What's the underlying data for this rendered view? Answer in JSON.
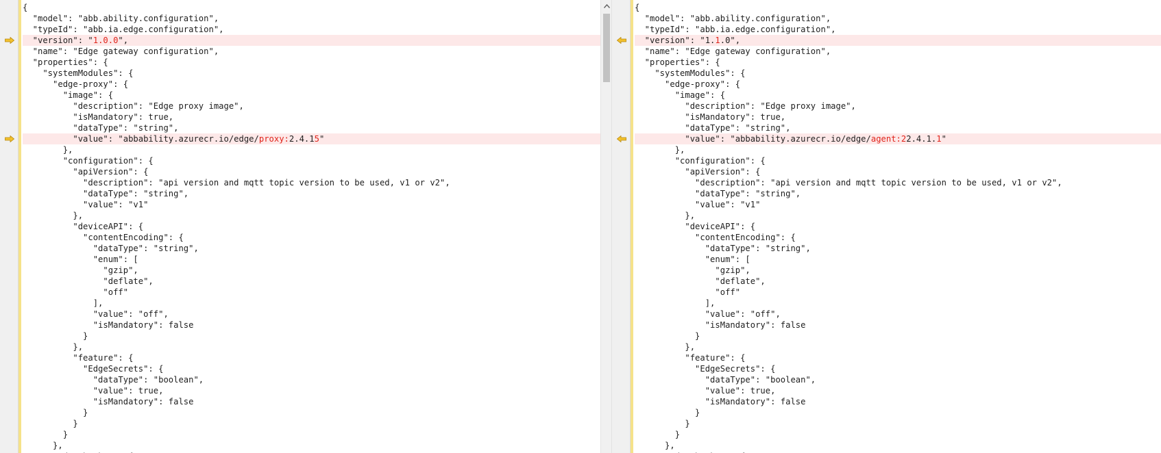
{
  "left": {
    "lines": [
      {
        "segs": [
          {
            "t": "{"
          }
        ]
      },
      {
        "segs": [
          {
            "t": "  \"model\": \"abb.ability.configuration\","
          }
        ]
      },
      {
        "segs": [
          {
            "t": "  \"typeId\": \"abb.ia.edge.configuration\","
          }
        ]
      },
      {
        "diff": true,
        "segs": [
          {
            "t": "  \"version\": \""
          },
          {
            "t": "1.0.0",
            "d": true
          },
          {
            "t": "\","
          }
        ]
      },
      {
        "segs": [
          {
            "t": "  \"name\": \"Edge gateway configuration\","
          }
        ]
      },
      {
        "segs": [
          {
            "t": "  \"properties\": {"
          }
        ]
      },
      {
        "segs": [
          {
            "t": "    \"systemModules\": {"
          }
        ]
      },
      {
        "segs": [
          {
            "t": "      \"edge-proxy\": {"
          }
        ]
      },
      {
        "segs": [
          {
            "t": "        \"image\": {"
          }
        ]
      },
      {
        "segs": [
          {
            "t": "          \"description\": \"Edge proxy image\","
          }
        ]
      },
      {
        "segs": [
          {
            "t": "          \"isMandatory\": true,"
          }
        ]
      },
      {
        "segs": [
          {
            "t": "          \"dataType\": \"string\","
          }
        ]
      },
      {
        "diff": true,
        "segs": [
          {
            "t": "          \"value\": \"abbability.azurecr.io/edge/"
          },
          {
            "t": "proxy:",
            "d": true
          },
          {
            "t": "2.4.1"
          },
          {
            "t": "5",
            "d": true
          },
          {
            "t": "\""
          }
        ]
      },
      {
        "segs": [
          {
            "t": "        },"
          }
        ]
      },
      {
        "segs": [
          {
            "t": "        \"configuration\": {"
          }
        ]
      },
      {
        "segs": [
          {
            "t": "          \"apiVersion\": {"
          }
        ]
      },
      {
        "segs": [
          {
            "t": "            \"description\": \"api version and mqtt topic version to be used, v1 or v2\","
          }
        ]
      },
      {
        "segs": [
          {
            "t": "            \"dataType\": \"string\","
          }
        ]
      },
      {
        "segs": [
          {
            "t": "            \"value\": \"v1\""
          }
        ]
      },
      {
        "segs": [
          {
            "t": "          },"
          }
        ]
      },
      {
        "segs": [
          {
            "t": "          \"deviceAPI\": {"
          }
        ]
      },
      {
        "segs": [
          {
            "t": "            \"contentEncoding\": {"
          }
        ]
      },
      {
        "segs": [
          {
            "t": "              \"dataType\": \"string\","
          }
        ]
      },
      {
        "segs": [
          {
            "t": "              \"enum\": ["
          }
        ]
      },
      {
        "segs": [
          {
            "t": "                \"gzip\","
          }
        ]
      },
      {
        "segs": [
          {
            "t": "                \"deflate\","
          }
        ]
      },
      {
        "segs": [
          {
            "t": "                \"off\""
          }
        ]
      },
      {
        "segs": [
          {
            "t": "              ],"
          }
        ]
      },
      {
        "segs": [
          {
            "t": "              \"value\": \"off\","
          }
        ]
      },
      {
        "segs": [
          {
            "t": "              \"isMandatory\": false"
          }
        ]
      },
      {
        "segs": [
          {
            "t": "            }"
          }
        ]
      },
      {
        "segs": [
          {
            "t": "          },"
          }
        ]
      },
      {
        "segs": [
          {
            "t": "          \"feature\": {"
          }
        ]
      },
      {
        "segs": [
          {
            "t": "            \"EdgeSecrets\": {"
          }
        ]
      },
      {
        "segs": [
          {
            "t": "              \"dataType\": \"boolean\","
          }
        ]
      },
      {
        "segs": [
          {
            "t": "              \"value\": true,"
          }
        ]
      },
      {
        "segs": [
          {
            "t": "              \"isMandatory\": false"
          }
        ]
      },
      {
        "segs": [
          {
            "t": "            }"
          }
        ]
      },
      {
        "segs": [
          {
            "t": "          }"
          }
        ]
      },
      {
        "segs": [
          {
            "t": "        }"
          }
        ]
      },
      {
        "segs": [
          {
            "t": "      },"
          }
        ]
      },
      {
        "segs": [
          {
            "t": "      \"edge-broker\": {"
          }
        ]
      }
    ]
  },
  "right": {
    "lines": [
      {
        "segs": [
          {
            "t": "{"
          }
        ]
      },
      {
        "segs": [
          {
            "t": "  \"model\": \"abb.ability.configuration\","
          }
        ]
      },
      {
        "segs": [
          {
            "t": "  \"typeId\": \"abb.ia.edge.configuration\","
          }
        ]
      },
      {
        "diff": true,
        "segs": [
          {
            "t": "  \"version\": \"1."
          },
          {
            "t": "1",
            "d": true
          },
          {
            "t": ".0\","
          }
        ]
      },
      {
        "segs": [
          {
            "t": "  \"name\": \"Edge gateway configuration\","
          }
        ]
      },
      {
        "segs": [
          {
            "t": "  \"properties\": {"
          }
        ]
      },
      {
        "segs": [
          {
            "t": "    \"systemModules\": {"
          }
        ]
      },
      {
        "segs": [
          {
            "t": "      \"edge-proxy\": {"
          }
        ]
      },
      {
        "segs": [
          {
            "t": "        \"image\": {"
          }
        ]
      },
      {
        "segs": [
          {
            "t": "          \"description\": \"Edge proxy image\","
          }
        ]
      },
      {
        "segs": [
          {
            "t": "          \"isMandatory\": true,"
          }
        ]
      },
      {
        "segs": [
          {
            "t": "          \"dataType\": \"string\","
          }
        ]
      },
      {
        "diff": true,
        "segs": [
          {
            "t": "          \"value\": \"abbability.azurecr.io/edge/"
          },
          {
            "t": "agent:2",
            "d": true
          },
          {
            "t": "2.4.1."
          },
          {
            "t": "1",
            "d": true
          },
          {
            "t": "\""
          }
        ]
      },
      {
        "segs": [
          {
            "t": "        },"
          }
        ]
      },
      {
        "segs": [
          {
            "t": "        \"configuration\": {"
          }
        ]
      },
      {
        "segs": [
          {
            "t": "          \"apiVersion\": {"
          }
        ]
      },
      {
        "segs": [
          {
            "t": "            \"description\": \"api version and mqtt topic version to be used, v1 or v2\","
          }
        ]
      },
      {
        "segs": [
          {
            "t": "            \"dataType\": \"string\","
          }
        ]
      },
      {
        "segs": [
          {
            "t": "            \"value\": \"v1\""
          }
        ]
      },
      {
        "segs": [
          {
            "t": "          },"
          }
        ]
      },
      {
        "segs": [
          {
            "t": "          \"deviceAPI\": {"
          }
        ]
      },
      {
        "segs": [
          {
            "t": "            \"contentEncoding\": {"
          }
        ]
      },
      {
        "segs": [
          {
            "t": "              \"dataType\": \"string\","
          }
        ]
      },
      {
        "segs": [
          {
            "t": "              \"enum\": ["
          }
        ]
      },
      {
        "segs": [
          {
            "t": "                \"gzip\","
          }
        ]
      },
      {
        "segs": [
          {
            "t": "                \"deflate\","
          }
        ]
      },
      {
        "segs": [
          {
            "t": "                \"off\""
          }
        ]
      },
      {
        "segs": [
          {
            "t": "              ],"
          }
        ]
      },
      {
        "segs": [
          {
            "t": "              \"value\": \"off\","
          }
        ]
      },
      {
        "segs": [
          {
            "t": "              \"isMandatory\": false"
          }
        ]
      },
      {
        "segs": [
          {
            "t": "            }"
          }
        ]
      },
      {
        "segs": [
          {
            "t": "          },"
          }
        ]
      },
      {
        "segs": [
          {
            "t": "          \"feature\": {"
          }
        ]
      },
      {
        "segs": [
          {
            "t": "            \"EdgeSecrets\": {"
          }
        ]
      },
      {
        "segs": [
          {
            "t": "              \"dataType\": \"boolean\","
          }
        ]
      },
      {
        "segs": [
          {
            "t": "              \"value\": true,"
          }
        ]
      },
      {
        "segs": [
          {
            "t": "              \"isMandatory\": false"
          }
        ]
      },
      {
        "segs": [
          {
            "t": "            }"
          }
        ]
      },
      {
        "segs": [
          {
            "t": "          }"
          }
        ]
      },
      {
        "segs": [
          {
            "t": "        }"
          }
        ]
      },
      {
        "segs": [
          {
            "t": "      },"
          }
        ]
      },
      {
        "segs": [
          {
            "t": "      \"edge-broker\": {"
          }
        ]
      }
    ]
  },
  "icons": {
    "left_marker": "arrow-right-icon",
    "right_marker": "arrow-left-icon",
    "scroll_up": "chevron-up-icon"
  },
  "colors": {
    "diff_text": "#e0241b",
    "diff_line_bg": "#fde8e8",
    "change_bar": "#f5e28a",
    "marker_fill": "#f2c12e"
  }
}
